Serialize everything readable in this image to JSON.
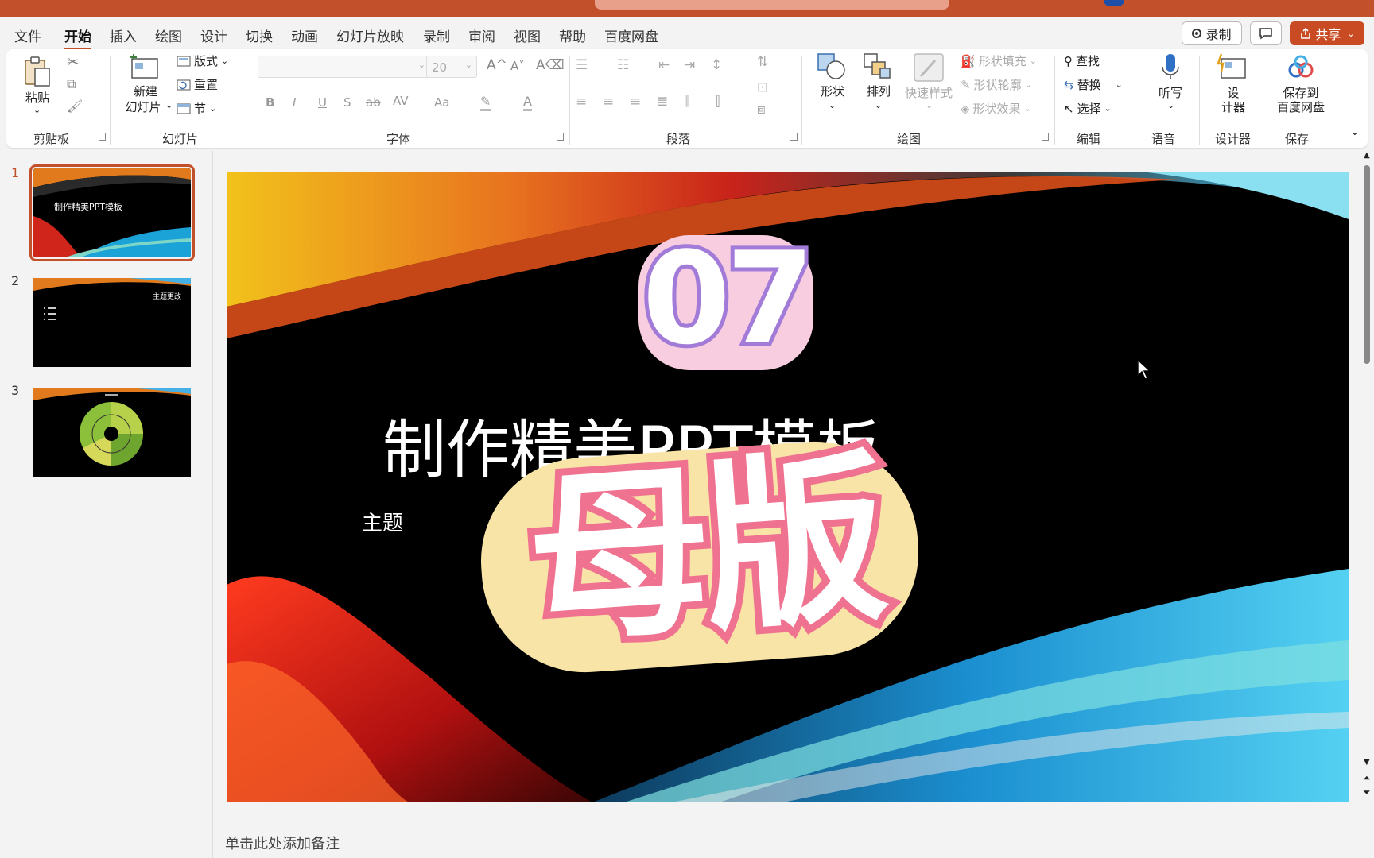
{
  "menu": {
    "tabs": [
      "文件",
      "开始",
      "插入",
      "绘图",
      "设计",
      "切换",
      "动画",
      "幻灯片放映",
      "录制",
      "审阅",
      "视图",
      "帮助",
      "百度网盘"
    ],
    "active_tab": "开始",
    "record_label": "录制",
    "share_label": "共享"
  },
  "ribbon": {
    "clipboard": {
      "paste": "粘贴",
      "group": "剪贴板"
    },
    "slides": {
      "new_slide": "新建",
      "new_slide_2": "幻灯片",
      "layout": "版式",
      "reset": "重置",
      "section": "节",
      "group": "幻灯片"
    },
    "font": {
      "font_size": "20",
      "bold": "B",
      "italic": "I",
      "underline": "U",
      "shadow": "S",
      "strike": "ab",
      "spacing": "AV",
      "case": "Aa",
      "color_a": "A",
      "group": "字体"
    },
    "paragraph": {
      "group": "段落"
    },
    "drawing": {
      "shapes": "形状",
      "arrange": "排列",
      "quick_styles": "快速样式",
      "fill": "形状填充",
      "outline": "形状轮廓",
      "effects": "形状效果",
      "group": "绘图"
    },
    "editing": {
      "find": "查找",
      "replace": "替换",
      "select": "选择",
      "group": "编辑"
    },
    "voice": {
      "dictate": "听写",
      "group": "语音"
    },
    "designer": {
      "label_1": "设",
      "label_2": "计器",
      "group": "设计器"
    },
    "save": {
      "label_1": "保存到",
      "label_2": "百度网盘",
      "group": "保存"
    }
  },
  "thumbnails": [
    {
      "num": "1",
      "title": "制作精美PPT模板"
    },
    {
      "num": "2",
      "title": "主题更改"
    },
    {
      "num": "3",
      "title": ""
    }
  ],
  "slide": {
    "badge_number": "07",
    "title": "制作精美PPT模板",
    "subtitle": "主题",
    "overlay_text": "母版"
  },
  "notes_placeholder": "单击此处添加备注",
  "colors": {
    "accent": "#c2502a",
    "share_bg": "#c84b24",
    "badge_stroke": "#a27ad8",
    "badge_outer": "#f8cde0",
    "overlay_stroke": "#ef7390",
    "overlay_outer": "#f8e4a6"
  }
}
